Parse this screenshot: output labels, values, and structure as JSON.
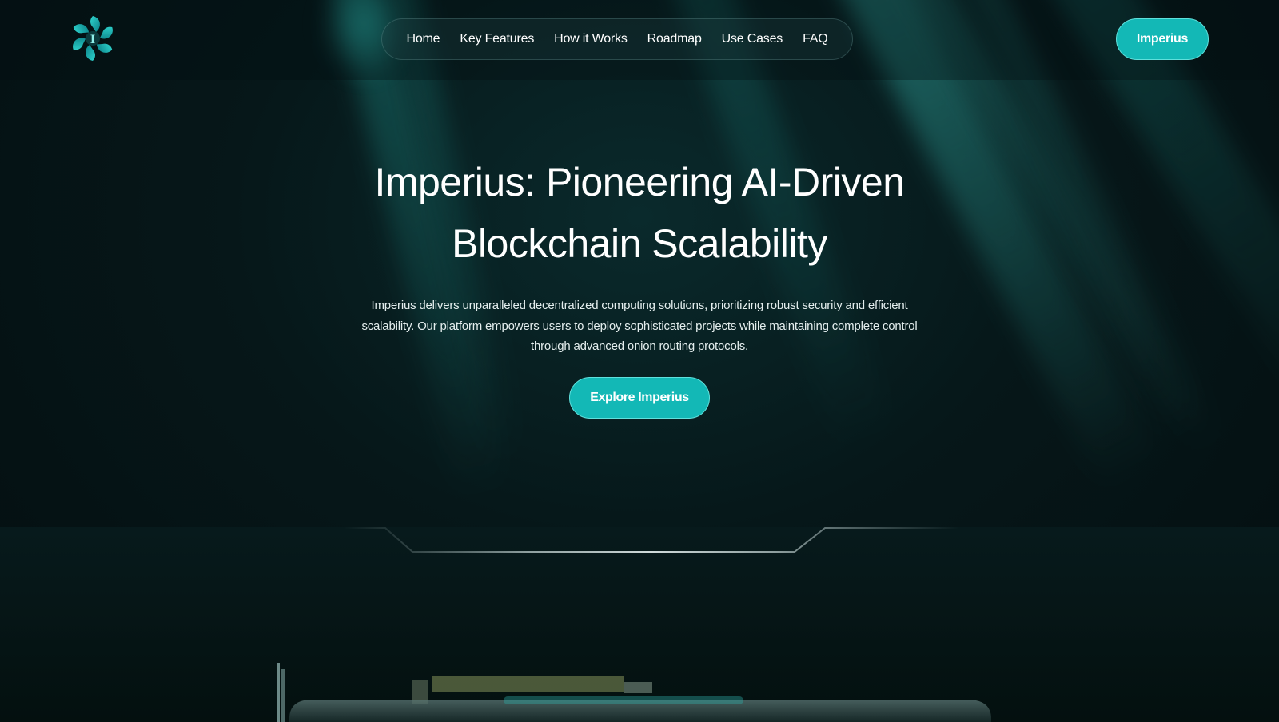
{
  "brand": {
    "logo_icon": "imperius-logo-icon",
    "logo_letter": "I",
    "accent_color": "#13b8b6"
  },
  "nav": {
    "items": [
      {
        "label": "Home"
      },
      {
        "label": "Key Features"
      },
      {
        "label": "How it Works"
      },
      {
        "label": "Roadmap"
      },
      {
        "label": "Use Cases"
      },
      {
        "label": "FAQ"
      }
    ]
  },
  "header": {
    "cta_label": "Imperius"
  },
  "hero": {
    "title_line1": "Imperius: Pioneering AI-Driven",
    "title_line2": "Blockchain Scalability",
    "subtitle_line1": "Imperius delivers unparalleled decentralized computing solutions, prioritizing robust security and efficient",
    "subtitle_line2": "scalability. Our platform empowers users to deploy sophisticated projects while maintaining complete control",
    "subtitle_line3": "through advanced onion routing protocols.",
    "cta_label": "Explore Imperius"
  }
}
